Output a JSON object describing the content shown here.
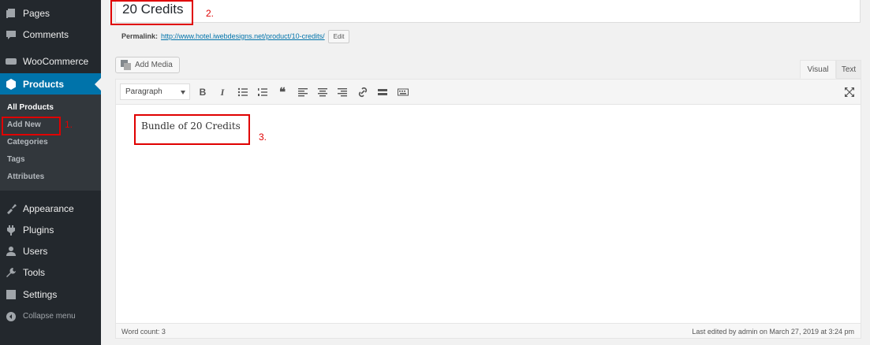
{
  "sidebar": {
    "items": [
      {
        "label": "Pages",
        "icon": "pages-icon"
      },
      {
        "label": "Comments",
        "icon": "comments-icon"
      },
      {
        "label": "WooCommerce",
        "icon": "woocommerce-icon"
      },
      {
        "label": "Products",
        "icon": "products-icon"
      },
      {
        "label": "Appearance",
        "icon": "appearance-icon"
      },
      {
        "label": "Plugins",
        "icon": "plugins-icon"
      },
      {
        "label": "Users",
        "icon": "users-icon"
      },
      {
        "label": "Tools",
        "icon": "tools-icon"
      },
      {
        "label": "Settings",
        "icon": "settings-icon"
      },
      {
        "label": "Collapse menu",
        "icon": "collapse-icon"
      }
    ],
    "submenu": [
      "All Products",
      "Add New",
      "Categories",
      "Tags",
      "Attributes"
    ],
    "active_color": "#0073aa",
    "bg_color": "#23282d"
  },
  "post": {
    "title": "20 Credits",
    "permalink_label": "Permalink:",
    "permalink_url": "http://www.hotel.iwebdesigns.net/product/10-credits/",
    "edit_label": "Edit"
  },
  "editor": {
    "add_media_label": "Add Media",
    "tabs": [
      "Visual",
      "Text"
    ],
    "format_value": "Paragraph",
    "content": "Bundle of 20 Credits",
    "word_count": "Word count: 3",
    "last_edited": "Last edited by admin on March 27, 2019 at 3:24 pm"
  },
  "annotations": [
    "1.",
    "2.",
    "3."
  ],
  "annotation_color": "#e00000"
}
